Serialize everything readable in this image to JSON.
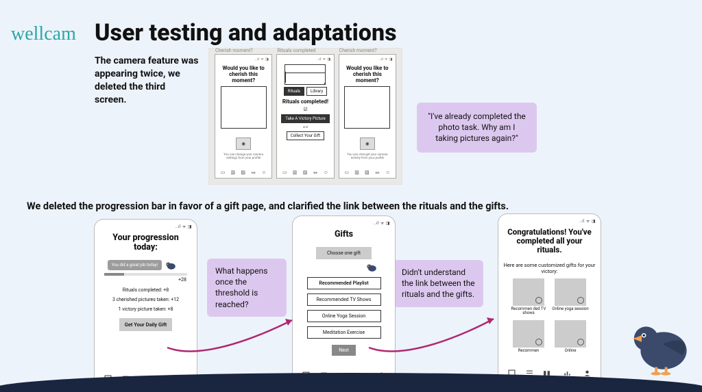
{
  "brand": "wellcam",
  "title": "User testing and adaptations",
  "caption1": "The camera feature was appearing twice, we deleted the third screen.",
  "caption2": "We deleted the progression bar in favor of a gift page, and clarified the link between the rituals and the gifts.",
  "quotes": {
    "photo_task": "\"I've already completed the photo task. Why am I taking pictures again?\"",
    "threshold": "What happens once the threshold is reached?",
    "link": "Didn't understand the link between the rituals and the gifts."
  },
  "wire": {
    "status": "..ıl ᯤ ◨",
    "cherish_head": "Cherish moment?",
    "completed_head": "Rituals completed",
    "cherish_q": "Would you like to cherish this moment?",
    "rituals_done": "Rituals completed!",
    "seg_a": "Rituals",
    "seg_b": "Library",
    "take_pic": "Take A Victory Picture",
    "and": "and",
    "collect": "Collect Your Gift",
    "cam_hint": "You can change your camera settings from your profile",
    "chat_hint": "You can chat get your camera activity from your profile"
  },
  "progression": {
    "title": "Your progression today:",
    "bubble": "You did a great job today!",
    "points": "+28",
    "lines": [
      "Rituals completed: +8",
      "3 cherished pictures taken: +12",
      "1 victory picture taken: +8"
    ],
    "cta": "Get Your Daily Gift"
  },
  "gifts": {
    "title": "Gifts",
    "hint": "Choose one gift",
    "items": [
      "Recommended Playlist",
      "Recommended TV Shows",
      "Online Yoga Session",
      "Meditation Exercise"
    ],
    "next": "Next"
  },
  "congrats": {
    "title": "Congratulations! You've completed all your rituals.",
    "sub": "Here are some customized gifts for your victory:",
    "cards": [
      "Recommen ded TV shows",
      "Online yoga session",
      "Recommen",
      "Online"
    ]
  },
  "nav": [
    "Rituals",
    "Tips",
    "Library",
    "Progress",
    "Profile"
  ]
}
